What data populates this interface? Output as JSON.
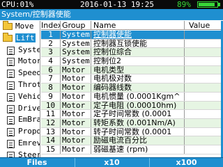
{
  "status": {
    "cpu": "CPU:01%",
    "datetime": "2016-01-13  19:25",
    "battery_pct": "89%",
    "battery_level": 0.89,
    "battery_color": "#38d838"
  },
  "path": "System/控制器使能",
  "tree": {
    "items": [
      {
        "label": "Move",
        "icon": "folder-icon",
        "level": 0,
        "selected": false
      },
      {
        "label": "Lift",
        "icon": "folder-icon",
        "level": 0,
        "selected": true
      },
      {
        "label": "Syste",
        "icon": "document-icon",
        "level": 1,
        "selected": false
      },
      {
        "label": "Motor",
        "icon": "document-icon",
        "level": 1,
        "selected": false
      },
      {
        "label": "Speed",
        "icon": "document-icon",
        "level": 1,
        "selected": false
      },
      {
        "label": "Throt",
        "icon": "document-icon",
        "level": 1,
        "selected": false
      },
      {
        "label": "Vehic",
        "icon": "document-icon",
        "level": 1,
        "selected": false
      },
      {
        "label": "Drive",
        "icon": "document-icon",
        "level": 1,
        "selected": false
      },
      {
        "label": "EmBra",
        "icon": "document-icon",
        "level": 1,
        "selected": false
      },
      {
        "label": "Propd",
        "icon": "document-icon",
        "level": 1,
        "selected": false
      },
      {
        "label": "Emrev",
        "icon": "document-icon",
        "level": 1,
        "selected": false
      },
      {
        "label": "Steer",
        "icon": "document-icon",
        "level": 1,
        "selected": false
      }
    ]
  },
  "table": {
    "headers": {
      "index": "Index",
      "group": "Group",
      "name": "Name",
      "value": "Value"
    },
    "rows": [
      {
        "index": "1",
        "group": "System",
        "name": "控制器使能",
        "value": ""
      },
      {
        "index": "2",
        "group": "System",
        "name": "控制器互锁使能",
        "value": ""
      },
      {
        "index": "3",
        "group": "System",
        "name": "控制位综合",
        "value": ""
      },
      {
        "index": "4",
        "group": "System",
        "name": "控制位2",
        "value": ""
      },
      {
        "index": "6",
        "group": "Motor",
        "name": "电机类型",
        "value": ""
      },
      {
        "index": "7",
        "group": "Motor",
        "name": "电机极对数",
        "value": ""
      },
      {
        "index": "8",
        "group": "Motor",
        "name": "编码器线数",
        "value": ""
      },
      {
        "index": "9",
        "group": "Motor",
        "name": "电机惯量 (0.0001Kgm^",
        "value": ""
      },
      {
        "index": "10",
        "group": "Motor",
        "name": "定子电阻 (0.00010hm)",
        "value": ""
      },
      {
        "index": "11",
        "group": "Motor",
        "name": "定子时间常数 (0.0001",
        "value": ""
      },
      {
        "index": "12",
        "group": "Motor",
        "name": "转矩系数 (0.001Nm/A)",
        "value": ""
      },
      {
        "index": "13",
        "group": "Motor",
        "name": "转子时间常数 (0.0001",
        "value": ""
      },
      {
        "index": "14",
        "group": "Motor",
        "name": "励磁电流百分比",
        "value": ""
      },
      {
        "index": "15",
        "group": "Motor",
        "name": "弱磁基速 (rpm)",
        "value": ""
      }
    ],
    "selected_row": 0
  },
  "softkeys": [
    "Files",
    "x10",
    "x100"
  ],
  "colors": {
    "accent": "#1f8fd0",
    "row_alt": "#e6f5e3",
    "statusbar": "#0a0a0a"
  }
}
